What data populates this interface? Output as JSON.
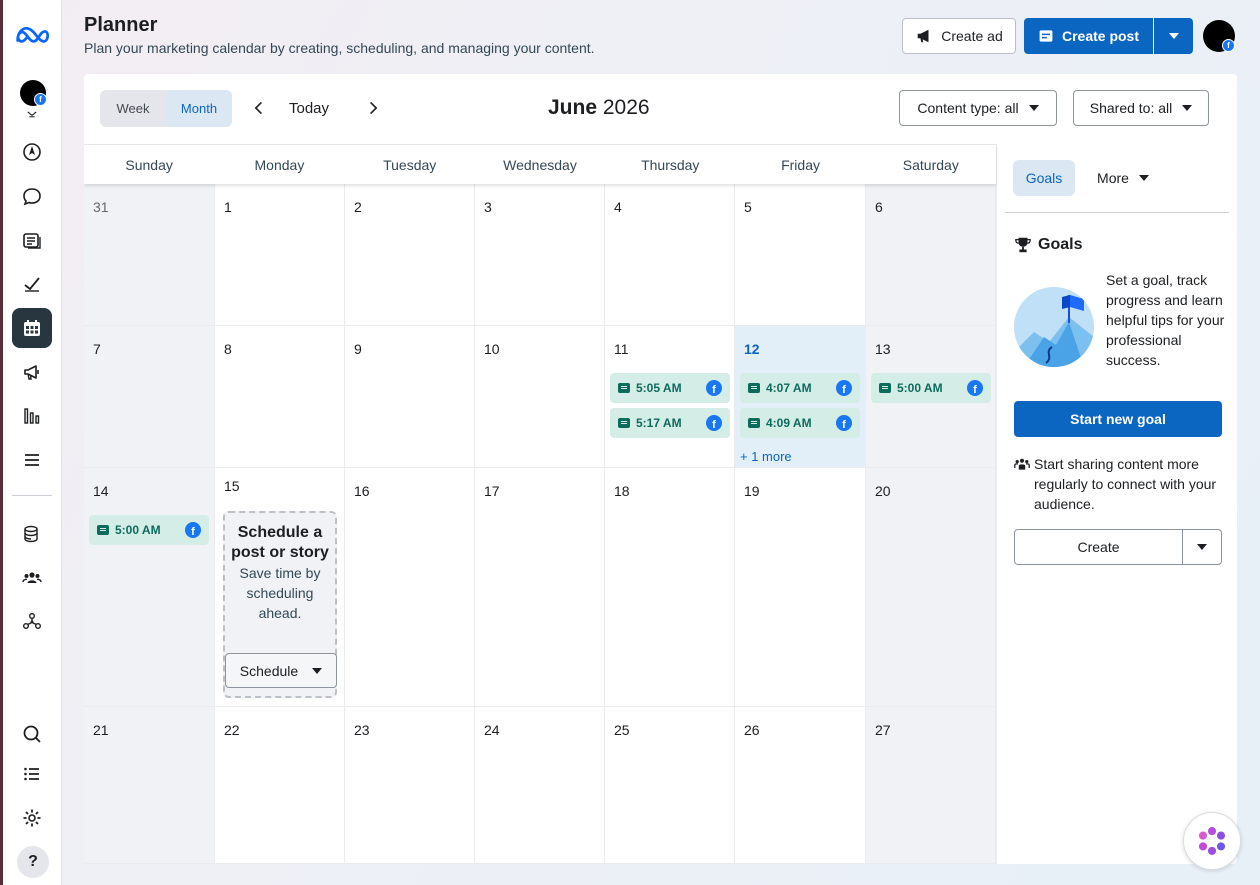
{
  "header": {
    "title": "Planner",
    "subtitle": "Plan your marketing calendar by creating, scheduling, and managing your content.",
    "create_ad_label": "Create ad",
    "create_post_label": "Create post"
  },
  "toolbar": {
    "view_week": "Week",
    "view_month": "Month",
    "selected_view": "Month",
    "today_label": "Today",
    "month": "June",
    "year": "2026",
    "content_type_filter": "Content type: all",
    "shared_to_filter": "Shared to: all"
  },
  "calendar": {
    "weekdays": [
      "Sunday",
      "Monday",
      "Tuesday",
      "Wednesday",
      "Thursday",
      "Friday",
      "Saturday"
    ],
    "weeks": [
      [
        "31",
        "1",
        "2",
        "3",
        "4",
        "5",
        "6"
      ],
      [
        "7",
        "8",
        "9",
        "10",
        "11",
        "12",
        "13"
      ],
      [
        "14",
        "15",
        "16",
        "17",
        "18",
        "19",
        "20"
      ],
      [
        "21",
        "22",
        "23",
        "24",
        "25",
        "26",
        "27"
      ]
    ],
    "today_date": "12",
    "events": {
      "thu11_a": "5:05 AM",
      "thu11_b": "5:17 AM",
      "fri12_a": "4:07 AM",
      "fri12_b": "4:09 AM",
      "sat13_a": "5:00 AM",
      "sun14_a": "5:00 AM"
    },
    "more_link": "+ 1 more",
    "schedule_prompt": {
      "heading": "Schedule a post or story",
      "body": "Save time by scheduling ahead.",
      "button_label": "Schedule"
    }
  },
  "right_panel": {
    "tab_goals": "Goals",
    "tab_more": "More",
    "goals_heading": "Goals",
    "goals_text": "Set a goal, track progress and learn helpful tips for your professional success.",
    "start_goal_label": "Start new goal",
    "share_text": "Start sharing content more regularly to connect with your audience.",
    "create_label": "Create"
  },
  "colors": {
    "primary": "#0b66c2",
    "sidebar_active": "#283640",
    "event_bg": "#d5ede7",
    "event_text": "#0d6b5c",
    "facebook_blue": "#1877f2",
    "today_bg": "#e2eef8"
  },
  "help_label": "?"
}
